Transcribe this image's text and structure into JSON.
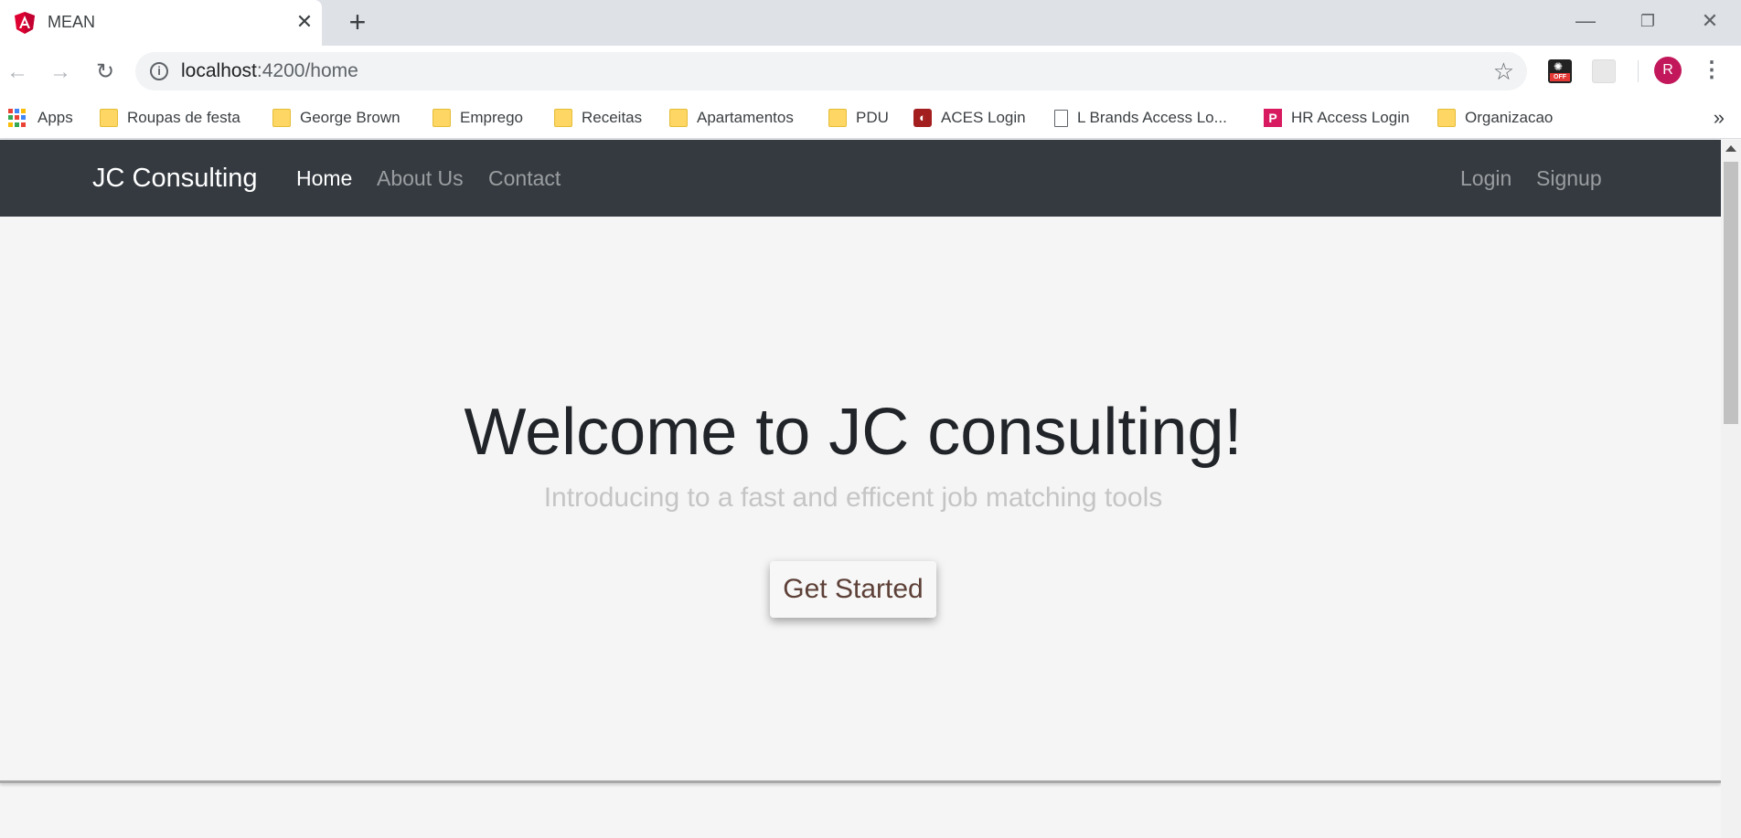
{
  "browser": {
    "tab_title": "MEAN",
    "new_tab_symbol": "+",
    "url_host": "localhost",
    "url_path": ":4200/home",
    "avatar_initial": "R",
    "bookmarks": [
      {
        "label": "Apps",
        "icon": "apps-grid-icon"
      },
      {
        "label": "Roupas de festa",
        "icon": "folder-icon"
      },
      {
        "label": "George Brown",
        "icon": "folder-icon"
      },
      {
        "label": "Emprego",
        "icon": "folder-icon"
      },
      {
        "label": "Receitas",
        "icon": "folder-icon"
      },
      {
        "label": "Apartamentos",
        "icon": "folder-icon"
      },
      {
        "label": "PDU",
        "icon": "folder-icon"
      },
      {
        "label": "ACES Login",
        "icon": "aces-icon"
      },
      {
        "label": "L Brands Access Lo...",
        "icon": "document-icon"
      },
      {
        "label": "HR Access Login",
        "icon": "hr-icon"
      },
      {
        "label": "Organizacao",
        "icon": "folder-icon"
      }
    ],
    "extension_badge": "OFF"
  },
  "navbar": {
    "brand": "JC Consulting",
    "links": [
      "Home",
      "About Us",
      "Contact"
    ],
    "right_links": [
      "Login",
      "Signup"
    ]
  },
  "hero": {
    "title": "Welcome to JC consulting!",
    "subtitle": "Introducing to a fast and efficent job matching tools",
    "cta_label": "Get Started"
  },
  "colors": {
    "navbar_bg": "#343a40",
    "page_bg": "#f5f5f5",
    "cta_text": "#5d4037",
    "avatar_bg": "#c2185b"
  }
}
